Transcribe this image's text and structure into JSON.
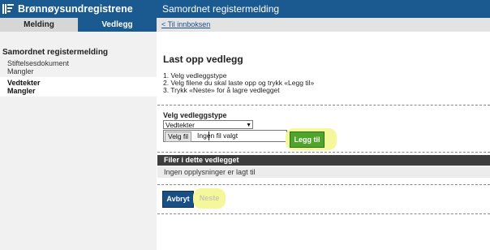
{
  "brand": {
    "name": "Brønnøysundregistrene",
    "logo_icon": "registry-logo-icon"
  },
  "tabs": [
    {
      "label": "Melding",
      "active": false
    },
    {
      "label": "Vedlegg",
      "active": true
    }
  ],
  "sidebar": {
    "title": "Samordnet registermelding",
    "items": [
      {
        "name": "Stiftelsesdokument",
        "status": "Mangler",
        "active": false
      },
      {
        "name": "Vedtekter",
        "status": "Mangler",
        "active": true
      }
    ]
  },
  "header": {
    "title": "Samordnet registermelding"
  },
  "breadcrumb": {
    "back_link": "< Til innboksen"
  },
  "main": {
    "heading": "Last opp vedlegg",
    "steps": [
      "1. Velg vedleggstype",
      "2. Velg filene du skal laste opp og trykk «Legg til»",
      "3. Trykk «Neste» for å lagre vedlegget"
    ],
    "type_label": "Velg vedleggstype",
    "type_selected": "Vedtekter",
    "file_button": "Velg fil",
    "file_status": "Ingen fil valgt",
    "add_button": "Legg til",
    "files_header": "Filer i dette vedlegget",
    "files_empty": "Ingen opplysninger er lagt til",
    "cancel_button": "Avbryt",
    "next_button": "Neste"
  },
  "colors": {
    "brand_blue": "#1a5a91",
    "add_green": "#4ea52a",
    "highlight_yellow": "#f4f79a"
  }
}
